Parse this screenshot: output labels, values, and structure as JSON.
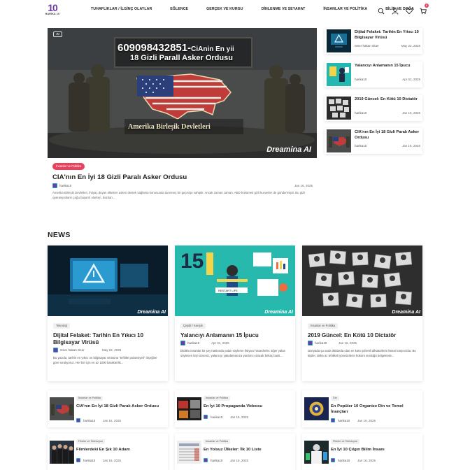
{
  "header": {
    "logo_mark": "10",
    "logo_text": "HARIKA 10",
    "nav": [
      "TUHAFLIKLAR / İLGİNÇ OLAYLAR",
      "EĞLENCE",
      "GERÇEK VE KURGU",
      "DİNLENME VE SEYAHAT",
      "İNSANLAR VE POLİTİKA",
      "BİLİM VE DOĞA"
    ],
    "cart_count": "0",
    "icons": [
      "search-icon",
      "user-icon",
      "heart-icon",
      "cart-icon"
    ]
  },
  "hero": {
    "ai_label": "AI",
    "image_number": "609098432851-",
    "image_number_suffix": "CiAnin En yii",
    "image_subtitle": "18 Gizli Parall  Asker Ordusu",
    "image_caption": "Amerika Birleşik Devletleri",
    "watermark": "Dreamina AI",
    "tag": "İnsanlar ve Politika",
    "title": "CIA'nın En İyi 18 Gizli Paralı Asker Ordusu",
    "author": "harika10",
    "date": "Jan 16, 2025",
    "excerpt": "Amerika Birleşik Devletleri, ihtiyaç duyan ülkelere askeri destek sağlama konusunda tanınmış bir geçmişe sahiptir. Ancak zaman zaman, ABD hükümeti gizli kuvvetler de göndermiştir. Bu gizli operasyonların çoğu başarılı olurken, bazıları..."
  },
  "sidebar": [
    {
      "title": "Dijital Felaket: Tarihin En Yıkıcı 10 Bilgisayar Virüsü",
      "author": "ömer hakan ölcer",
      "date": "May 22, 2025"
    },
    {
      "title": "Yalancıyı Anlamanın 15 İpucu",
      "author": "harika10",
      "date": "Apr 01, 2025"
    },
    {
      "title": "2019 Güncel: En Kötü 10 Dictatör",
      "author": "harika10",
      "date": "Jan 16, 2025"
    },
    {
      "title": "CIA'nın En İyi 18 Gizli Paralı Asker Ordusu",
      "author": "harika10",
      "date": "Jan 16, 2025"
    }
  ],
  "news": {
    "heading": "NEWS",
    "cards": [
      {
        "tag": "Teknoloji",
        "title": "Dijital Felaket: Tarihin En Yıkıcı 10 Bilgisayar Virüsü",
        "author": "ömer hakan ölcer",
        "date": "May 22, 2025",
        "excerpt": "Bu yazıda, tarihin en yıkıcı on bilgisayar virüsünü \"tehlike potansiyeli\" ölçeğine göre sıralıyoruz. Her biri için en az 1000 karakterlik..."
      },
      {
        "tag": "Çeşitli / Karışık",
        "title": "Yalancıyı Anlamanın 15 İpucu",
        "author": "harika10",
        "date": "Apr 01, 2025",
        "excerpt": "bildiklo insanlar bir şey hakkında yalan söyleme ihtiyacı hissederler. Eğer yalan söylenen kişi sizseniz, yalancıyı yakalamanıza yardımcı olacak birkaç basit..."
      },
      {
        "tag": "İnsanlar ve Politika",
        "title": "2019 Güncel: En Kötü 10 Dictatör",
        "author": "harika10",
        "date": "Jan 16, 2025",
        "excerpt": "Dünyada şu anda iktidarda olan en kötü şöhretli diktatörlerin listesi karşınızda. Bu kişiler, daha az tehlikeli yöneticilerin hüküm sürdüğü bölgelerde..."
      }
    ],
    "thumb_watermark": "Dreamina AI",
    "thumb_number": "15",
    "thumb_tips_label": "RESTART LIFE"
  },
  "small_cards": [
    {
      "tag": "İnsanlar ve Politika",
      "title": "CIA'nın En İyi 18 Gizli Paralı Asker Ordusu",
      "author": "harika10",
      "date": "Jan 16, 2025"
    },
    {
      "tag": "İnsanlar ve Politika",
      "title": "En İyi 10 Propaganda Videosu",
      "author": "harika10",
      "date": "Jan 16, 2025"
    },
    {
      "tag": "Din",
      "title": "En Popüler 10 Organize Din ve Temel İnançları",
      "author": "harika10",
      "date": "Jan 16, 2025"
    },
    {
      "tag": "Filmler ve Televizyon",
      "title": "Filmlerdeki En Şık 10 Adam",
      "author": "harika10",
      "date": "Jan 16, 2025"
    },
    {
      "tag": "İnsanlar ve Politika",
      "title": "En Yolsuz Ülkeler: İlk 10 Liste",
      "author": "harika10",
      "date": "Jan 16, 2025"
    },
    {
      "tag": "Filmler ve Televizyon",
      "title": "En İyi 10 Çılgın Bilim İnsanı",
      "author": "harika10",
      "date": "Jan 16, 2025"
    }
  ]
}
